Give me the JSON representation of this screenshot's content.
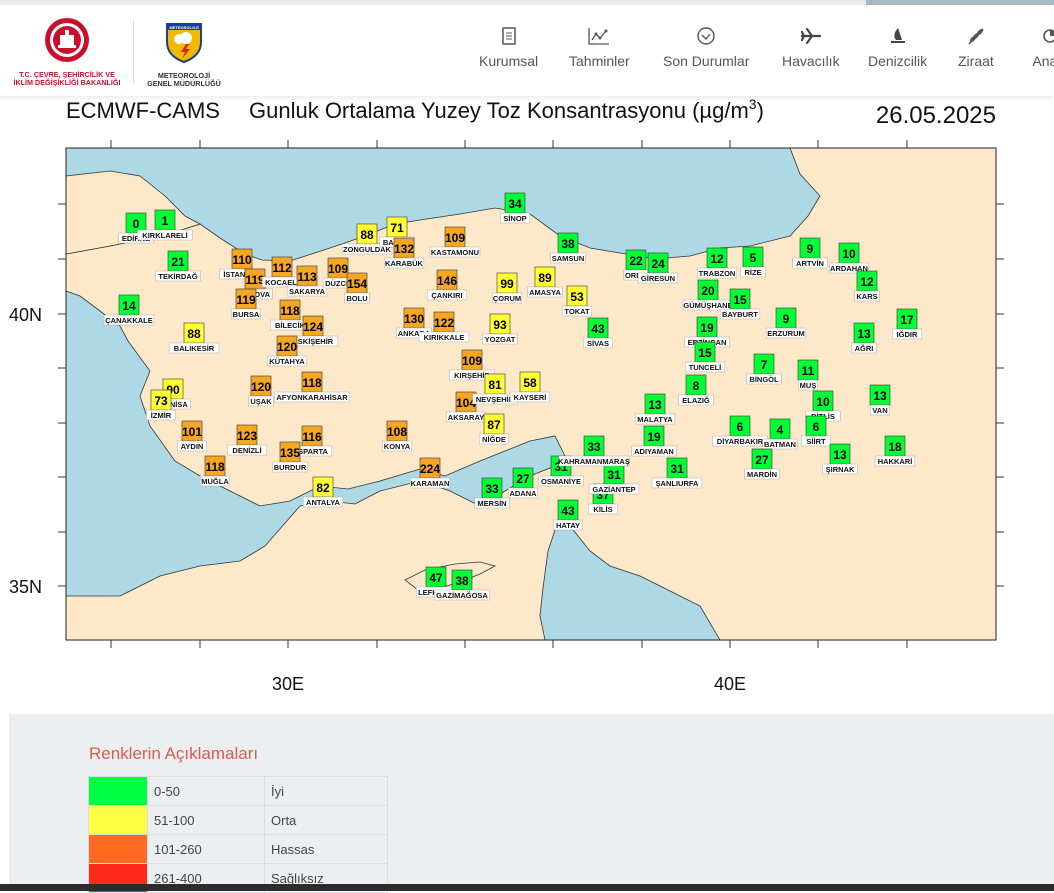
{
  "header": {
    "ministry_line1": "T.C. ÇEVRE, ŞEHİRCİLİK VE",
    "ministry_line2": "İKLİM DEĞİŞİKLİĞİ BAKANLIĞI",
    "mgm_badge": "METEOROLOJİ",
    "mgm_line1": "METEOROLOJİ",
    "mgm_line2": "GENEL MÜDÜRLÜĞÜ"
  },
  "nav": [
    {
      "label": "Kurumsal",
      "icon": "document-icon"
    },
    {
      "label": "Tahminler",
      "icon": "forecast-chart-icon"
    },
    {
      "label": "Son Durumlar",
      "icon": "check-circle-icon"
    },
    {
      "label": "Havacılık",
      "icon": "airplane-icon"
    },
    {
      "label": "Denizcilik",
      "icon": "sailboat-icon"
    },
    {
      "label": "Ziraat",
      "icon": "wheat-icon"
    },
    {
      "label": "Anali",
      "icon": "analysis-icon"
    }
  ],
  "map": {
    "model": "ECMWF-CAMS",
    "title_main": "Gunluk Ortalama Yuzey Toz Konsantrasyonu (µg/m",
    "title_sup": "3",
    "title_close": ")",
    "date": "26.05.2025",
    "ylabels": [
      "40N",
      "35N"
    ],
    "xlabels": [
      "30E",
      "40E"
    ],
    "colors": {
      "green": "#00ff33",
      "yellow": "#ffff33",
      "orange": "#f5a623",
      "sea": "#add8e6",
      "land": "#fde9c9"
    },
    "stations": [
      {
        "name": "EDİRNE",
        "value": 0,
        "c": "green"
      },
      {
        "name": "KIRKLARELİ",
        "value": 1,
        "c": "green"
      },
      {
        "name": "TEKİRDAĞ",
        "value": 21,
        "c": "green"
      },
      {
        "name": "ÇANAKKALE",
        "value": 14,
        "c": "green"
      },
      {
        "name": "BALIKESİR",
        "value": 88,
        "c": "yellow"
      },
      {
        "name": "İSTANBUL",
        "value": 110,
        "c": "orange"
      },
      {
        "name": "YALOVA",
        "value": 119,
        "c": "orange"
      },
      {
        "name": "KOCAELİ",
        "value": 112,
        "c": "orange"
      },
      {
        "name": "SAKARYA",
        "value": 113,
        "c": "orange"
      },
      {
        "name": "DÜZCE",
        "value": 109,
        "c": "orange"
      },
      {
        "name": "BOLU",
        "value": 154,
        "c": "orange"
      },
      {
        "name": "BURSA",
        "value": 119,
        "c": "orange"
      },
      {
        "name": "BİLECİK",
        "value": 118,
        "c": "orange"
      },
      {
        "name": "ESKİŞEHİR",
        "value": 124,
        "c": "orange"
      },
      {
        "name": "KÜTAHYA",
        "value": 120,
        "c": "orange"
      },
      {
        "name": "MANİSA",
        "value": 90,
        "c": "yellow"
      },
      {
        "name": "İZMİR",
        "value": 73,
        "c": "yellow"
      },
      {
        "name": "UŞAK",
        "value": 120,
        "c": "orange"
      },
      {
        "name": "AFYONKARAHİSAR",
        "value": 118,
        "c": "orange"
      },
      {
        "name": "AYDIN",
        "value": 101,
        "c": "orange"
      },
      {
        "name": "DENİZLİ",
        "value": 123,
        "c": "orange"
      },
      {
        "name": "ISPARTA",
        "value": 116,
        "c": "orange"
      },
      {
        "name": "BURDUR",
        "value": 135,
        "c": "orange"
      },
      {
        "name": "MUĞLA",
        "value": 118,
        "c": "orange"
      },
      {
        "name": "ANTALYA",
        "value": 82,
        "c": "yellow"
      },
      {
        "name": "ZONGULDAK",
        "value": 88,
        "c": "yellow"
      },
      {
        "name": "BARTIN",
        "value": 71,
        "c": "yellow"
      },
      {
        "name": "KARABÜK",
        "value": 132,
        "c": "orange"
      },
      {
        "name": "KASTAMONU",
        "value": 109,
        "c": "orange"
      },
      {
        "name": "ÇANKIRI",
        "value": 146,
        "c": "orange"
      },
      {
        "name": "ANKARA",
        "value": 130,
        "c": "orange"
      },
      {
        "name": "KIRIKKALE",
        "value": 122,
        "c": "orange"
      },
      {
        "name": "KIRŞEHİR",
        "value": 109,
        "c": "orange"
      },
      {
        "name": "AKSARAY",
        "value": 104,
        "c": "orange"
      },
      {
        "name": "KONYA",
        "value": 108,
        "c": "orange"
      },
      {
        "name": "KARAMAN",
        "value": 224,
        "c": "orange"
      },
      {
        "name": "SİNOP",
        "value": 34,
        "c": "green"
      },
      {
        "name": "SAMSUN",
        "value": 38,
        "c": "green"
      },
      {
        "name": "ÇORUM",
        "value": 99,
        "c": "yellow"
      },
      {
        "name": "AMASYA",
        "value": 89,
        "c": "yellow"
      },
      {
        "name": "TOKAT",
        "value": 53,
        "c": "yellow"
      },
      {
        "name": "YOZGAT",
        "value": 93,
        "c": "yellow"
      },
      {
        "name": "NEVŞEHİR",
        "value": 81,
        "c": "yellow"
      },
      {
        "name": "KAYSERİ",
        "value": 58,
        "c": "yellow"
      },
      {
        "name": "NİĞDE",
        "value": 87,
        "c": "yellow"
      },
      {
        "name": "SİVAS",
        "value": 43,
        "c": "green"
      },
      {
        "name": "MERSİN",
        "value": 33,
        "c": "green"
      },
      {
        "name": "ADANA",
        "value": 27,
        "c": "green"
      },
      {
        "name": "OSMANİYE",
        "value": 31,
        "c": "green"
      },
      {
        "name": "HATAY",
        "value": 43,
        "c": "green"
      },
      {
        "name": "KİLİS",
        "value": 37,
        "c": "green"
      },
      {
        "name": "GAZİANTEP",
        "value": 31,
        "c": "green"
      },
      {
        "name": "KAHRAMANMARAŞ",
        "value": 33,
        "c": "green"
      },
      {
        "name": "ADIYAMAN",
        "value": 19,
        "c": "green"
      },
      {
        "name": "MALATYA",
        "value": 13,
        "c": "green"
      },
      {
        "name": "ŞANLIURFA",
        "value": 31,
        "c": "green"
      },
      {
        "name": "ORDU",
        "value": 22,
        "c": "green"
      },
      {
        "name": "GİRESUN",
        "value": 24,
        "c": "green"
      },
      {
        "name": "TRABZON",
        "value": 12,
        "c": "green"
      },
      {
        "name": "RİZE",
        "value": 5,
        "c": "green"
      },
      {
        "name": "ARTVİN",
        "value": 9,
        "c": "green"
      },
      {
        "name": "ARDAHAN",
        "value": 10,
        "c": "green"
      },
      {
        "name": "KARS",
        "value": 12,
        "c": "green"
      },
      {
        "name": "GÜMÜŞHANE",
        "value": 20,
        "c": "green"
      },
      {
        "name": "BAYBURT",
        "value": 15,
        "c": "green"
      },
      {
        "name": "ERZİNCAN",
        "value": 19,
        "c": "green"
      },
      {
        "name": "TUNCELİ",
        "value": 15,
        "c": "green"
      },
      {
        "name": "ERZURUM",
        "value": 9,
        "c": "green"
      },
      {
        "name": "AĞRI",
        "value": 13,
        "c": "green"
      },
      {
        "name": "IĞDIR",
        "value": 17,
        "c": "green"
      },
      {
        "name": "ELAZIĞ",
        "value": 8,
        "c": "green"
      },
      {
        "name": "BİNGÖL",
        "value": 7,
        "c": "green"
      },
      {
        "name": "MUŞ",
        "value": 11,
        "c": "green"
      },
      {
        "name": "BİTLİS",
        "value": 10,
        "c": "green"
      },
      {
        "name": "VAN",
        "value": 13,
        "c": "green"
      },
      {
        "name": "DİYARBAKIR",
        "value": 6,
        "c": "green"
      },
      {
        "name": "BATMAN",
        "value": 4,
        "c": "green"
      },
      {
        "name": "SİİRT",
        "value": 6,
        "c": "green"
      },
      {
        "name": "MARDİN",
        "value": 27,
        "c": "green"
      },
      {
        "name": "ŞIRNAK",
        "value": 13,
        "c": "green"
      },
      {
        "name": "HAKKARİ",
        "value": 18,
        "c": "green"
      },
      {
        "name": "LEFKOŞA",
        "value": 47,
        "c": "green"
      },
      {
        "name": "GAZİMAĞOSA",
        "value": 38,
        "c": "green"
      }
    ]
  },
  "legend": {
    "title": "Renklerin Açıklamaları",
    "rows": [
      {
        "range": "0-50",
        "label": "İyi",
        "color": "#00ff44"
      },
      {
        "range": "51-100",
        "label": "Orta",
        "color": "#ffff44"
      },
      {
        "range": "101-260",
        "label": "Hassas",
        "color": "#ff6a22"
      },
      {
        "range": "261-400",
        "label": "Sağlıksız",
        "color": "#ff2a1a"
      }
    ]
  }
}
